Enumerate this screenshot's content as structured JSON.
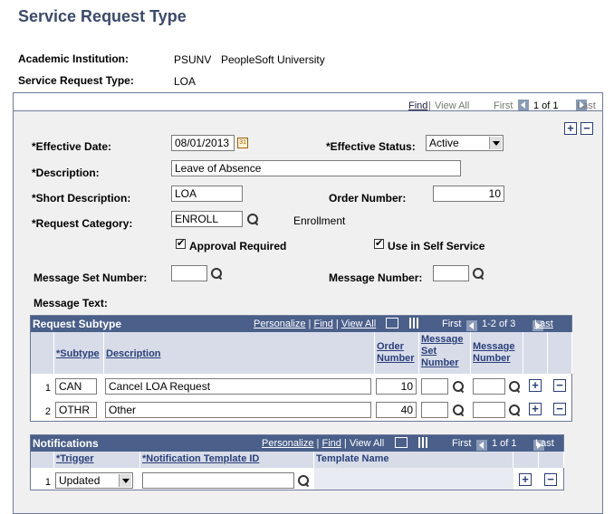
{
  "page": {
    "title": "Service Request Type"
  },
  "header": {
    "institution_label": "Academic Institution:",
    "institution_code": "PSUNV",
    "institution_name": "PeopleSoft University",
    "request_type_label": "Service Request Type:",
    "request_type_value": "LOA"
  },
  "nav": {
    "find": "Find",
    "view_all": "View All",
    "first": "First",
    "range": "1 of 1",
    "last": "Last"
  },
  "form": {
    "effective_date_label": "*Effective Date:",
    "effective_date": "08/01/2013",
    "calendar_glyph": "31",
    "effective_status_label": "*Effective Status:",
    "effective_status": "Active",
    "description_label": "*Description:",
    "description": "Leave of Absence",
    "short_description_label": "*Short Description:",
    "short_description": "LOA",
    "order_number_label": "Order Number:",
    "order_number": "10",
    "request_category_label": "*Request Category:",
    "request_category": "ENROLL",
    "request_category_desc": "Enrollment",
    "approval_required_label": "Approval Required",
    "approval_required": "✔",
    "self_service_label": "Use in Self Service",
    "self_service": "✔",
    "message_set_label": "Message Set Number:",
    "message_number_label": "Message Number:",
    "message_text_label": "Message Text:"
  },
  "subtype_grid": {
    "title": "Request Subtype",
    "personalize": "Personalize",
    "find": "Find",
    "view_all": "View All",
    "first": "First",
    "range": "1-2 of 3",
    "last": "Last",
    "col_subtype": "*Subtype",
    "col_description": "Description",
    "col_order": "Order Number",
    "col_msgset": "Message Set Number",
    "col_msgnum": "Message Number",
    "rows": [
      {
        "num": "1",
        "subtype": "CAN",
        "description": "Cancel LOA Request",
        "order": "10"
      },
      {
        "num": "2",
        "subtype": "OTHR",
        "description": "Other",
        "order": "40"
      }
    ]
  },
  "notif_grid": {
    "title": "Notifications",
    "personalize": "Personalize",
    "find": "Find",
    "view_all": "View All",
    "first": "First",
    "range": "1 of 1",
    "last": "Last",
    "col_trigger": "*Trigger",
    "col_template_id": "*Notification Template ID",
    "col_template_name": "Template Name",
    "rows": [
      {
        "num": "1",
        "trigger": "Updated"
      }
    ]
  },
  "buttons": {
    "add": "+",
    "remove": "−"
  }
}
